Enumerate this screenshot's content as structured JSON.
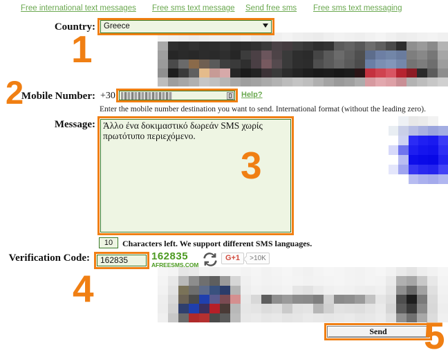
{
  "linkbar": {
    "links": [
      "Free international text messages",
      "Free sms text message",
      "Send free sms",
      "Free sms text messaging"
    ]
  },
  "form": {
    "country_label": "Country:",
    "country_value": "Greece",
    "mobile_label": "Mobile Number:",
    "mobile_prefix": "+30",
    "mobile_value": "",
    "help_link": "Help?",
    "mobile_hint": "Enter the mobile number destination you want to send. International format (without the leading zero).",
    "message_label": "Message:",
    "message_value": "Άλλο ένα δοκιμαστικό δωρεάν SMS χωρίς πρωτότυπο περιεχόμενο.",
    "chars_left_value": "10",
    "chars_left_text": "Characters left. We support different SMS languages.",
    "verify_label": "Verification Code:",
    "verify_value": "162835",
    "send_label": "Send"
  },
  "captcha": {
    "code": "162835",
    "brand": "AFREESMS.COM",
    "refresh_icon": "refresh-icon"
  },
  "social": {
    "gplus_label": "G+1",
    "gplus_count": ">10K"
  },
  "steps": {
    "one": "1",
    "two": "2",
    "three": "3",
    "four": "4",
    "five": "5"
  },
  "colors": {
    "highlight": "#f07f13",
    "link_green": "#6aa84f",
    "field_bg": "#eef5e3",
    "field_border": "#3a7a28",
    "captcha_green": "#4c9a21",
    "gplus_red": "#d24b3e"
  },
  "ads": {
    "top": {
      "cols": 28,
      "rows": 6,
      "cells": [
        "#f4f4f4",
        "#f2f2f2",
        "#f0f0f0",
        "#ededed",
        "#efefef",
        "#f1f1f1",
        "#eeeeee",
        "#ececec",
        "#f0f0f0",
        "#eaeaea",
        "#e8e8e8",
        "#f0f0f0",
        "#f3f3f3",
        "#efefef",
        "#ededed",
        "#ebebeb",
        "#efefef",
        "#f2f2f2",
        "#f0f0f0",
        "#eeeeee",
        "#f1f1f1",
        "#f4f4f4",
        "#f0f0f0",
        "#ececec",
        "#eeeeee",
        "#f1f1f1",
        "#f3f3f3",
        "#f0f0f0",
        "#a9a9a9",
        "#2f2f2f",
        "#2b2b2b",
        "#303030",
        "#2c2c2c",
        "#2e2e2e",
        "#333333",
        "#2a2a2a",
        "#2d2d2d",
        "#313131",
        "#3a3a3a",
        "#4a4246",
        "#453c40",
        "#3d3d3d",
        "#363636",
        "#2e2e2e",
        "#333333",
        "#5b5b5b",
        "#636363",
        "#585858",
        "#6d6d6d",
        "#5f5f5f",
        "#4a4a4a",
        "#2d2d2d",
        "#8f8f8f",
        "#9a9a9a",
        "#8a8a8a",
        "#b4b4b4",
        "#9f9f9f",
        "#262626",
        "#2a2a2a",
        "#282828",
        "#2c2c2c",
        "#2a2a2a",
        "#2e2e2e",
        "#262626",
        "#3c3c3c",
        "#4b4045",
        "#6b555c",
        "#4d4347",
        "#3a3a3a",
        "#2e2e2e",
        "#2b2b2b",
        "#454545",
        "#5a5a5a",
        "#6b6b6b",
        "#5e5e5e",
        "#4f4f4f",
        "#5d6d8c",
        "#6d7fa4",
        "#7286a8",
        "#6a7c9e",
        "#7e7e7e",
        "#888888",
        "#777777",
        "#a6a6a6",
        "#9a9a9a",
        "#4a4a4a",
        "#6a6a6a",
        "#8a6a4a",
        "#6f5f52",
        "#5a5a5a",
        "#3e3e3e",
        "#3a3a3a",
        "#2f2f2f",
        "#4a3f44",
        "#77595f",
        "#554a4e",
        "#3a3a3a",
        "#2e2e2e",
        "#2c2c2c",
        "#4e4e4e",
        "#5a5a5a",
        "#666666",
        "#5a5a5a",
        "#4c4c4c",
        "#6a7fa6",
        "#7b8fb3",
        "#8296ba",
        "#7487ab",
        "#747474",
        "#7d7d7d",
        "#6e6e6e",
        "#9d9d9d",
        "#8f8f8f",
        "#1d1d1d",
        "#3a3a3a",
        "#5f5f5f",
        "#e4bb8b",
        "#c79b96",
        "#d6a9a9",
        "#262626",
        "#1b1b1b",
        "#222222",
        "#3c3236",
        "#3a3a3a",
        "#2c2c2c",
        "#242424",
        "#1e1e1e",
        "#1a1a1a",
        "#1c1c1c",
        "#181818",
        "#1b1b1b",
        "#2a1416",
        "#c4313f",
        "#cf4350",
        "#d85563",
        "#b62330",
        "#8c1b24",
        "#2a2a2a",
        "#5c5c5c",
        "#8e8e8e",
        "#bdbdbd",
        "#9d9d9d",
        "#a6a6a6",
        "#b0b0b0",
        "#c6c6c6",
        "#c0c0c0",
        "#b6b6b6",
        "#a8a8a8",
        "#9e9e9e",
        "#a2a2a2",
        "#aaaaaa",
        "#b2b2b2",
        "#bcbcbc",
        "#c4c4c4",
        "#bebebe",
        "#b0b0b0",
        "#a4a4a4",
        "#9a9a9a",
        "#a0a0a0",
        "#acacac",
        "#d79aa0",
        "#e2a8ae",
        "#dda0a6",
        "#c98f95",
        "#b3b3b3",
        "#bdbdbd",
        "#c7c7c7",
        "#d0d0d0"
      ]
    },
    "right": {
      "cols": 6,
      "rows": 7,
      "cells": [
        "#ffffff",
        "#eef1f5",
        "#e8e8e8",
        "#ebebeb",
        "#f2f2f2",
        "#ffffff",
        "#e9eef3",
        "#c9cfe8",
        "#b6bde4",
        "#a8b0e0",
        "#9aa4dd",
        "#a3ade2",
        "#ffffff",
        "#cdd2f2",
        "#2b2bf5",
        "#1f1ff2",
        "#1a1af0",
        "#3a3af6",
        "#d7d9fa",
        "#6f74ee",
        "#1e1ef0",
        "#1515ee",
        "#1212ec",
        "#2e2ef4",
        "#ffffff",
        "#b8bcf2",
        "#0e0eea",
        "#0a0ae8",
        "#0808e6",
        "#2222f0",
        "#e4e6fb",
        "#9fa4ef",
        "#3636f2",
        "#2929f0",
        "#2424ee",
        "#4242f6",
        "#ffffff",
        "#ffffff",
        "#b7bcf1",
        "#aab0ee",
        "#a4aaec",
        "#b0b6f0"
      ]
    },
    "bottom": {
      "cols": 28,
      "rows": 6,
      "cells": [
        "#f6f6f6",
        "#f4f4f4",
        "#e6e6e6",
        "#e9e9e9",
        "#f2f2f2",
        "#f0f0f0",
        "#f4f4f4",
        "#f6f6f6",
        "#f3f3f3",
        "#f5f5f5",
        "#f2f2f2",
        "#f4f4f4",
        "#f6f6f6",
        "#f3f3f3",
        "#f1f1f1",
        "#f4f4f4",
        "#f6f6f6",
        "#f5f5f5",
        "#f3f3f3",
        "#f2f2f2",
        "#f4f4f4",
        "#f6f6f6",
        "#f2f2f2",
        "#eaeaea",
        "#e4e4e4",
        "#eeeeee",
        "#f2f2f2",
        "#f6f6f6",
        "#f4f4f4",
        "#e8e8e8",
        "#b9b9b9",
        "#8d8d8d",
        "#6f6f6f",
        "#5e5e5e",
        "#9a9a9a",
        "#d6d6d6",
        "#f0f0f0",
        "#f4f4f4",
        "#f2f2f2",
        "#f3f3f3",
        "#f5f5f5",
        "#f4f4f4",
        "#f2f2f2",
        "#f3f3f3",
        "#f4f4f4",
        "#f5f5f5",
        "#f3f3f3",
        "#f2f2f2",
        "#f4f4f4",
        "#f3f3f3",
        "#eaeaea",
        "#b0b0b0",
        "#a6a6a6",
        "#c8c8c8",
        "#e8e8e8",
        "#f4f4f4",
        "#f2f2f2",
        "#e2e2e2",
        "#7a7258",
        "#6e6e6e",
        "#5d6b8a",
        "#39517e",
        "#2a3c6a",
        "#b4b4b4",
        "#eeeeee",
        "#f2f2f2",
        "#f0f0f0",
        "#f1f1f1",
        "#f3f3f3",
        "#e6e6e6",
        "#e2e2e2",
        "#eaeaea",
        "#f0f0f0",
        "#f2f2f2",
        "#f1f1f1",
        "#eeeeee",
        "#ededed",
        "#f0f0f0",
        "#e4e4e4",
        "#8f8f8f",
        "#6a6a6a",
        "#a2a2a2",
        "#e0e0e0",
        "#f2f2f2",
        "#eeeeee",
        "#d9d9d9",
        "#6b6254",
        "#4a4a4a",
        "#1f3fae",
        "#5a5a8e",
        "#7a4a52",
        "#d58f8f",
        "#e8e8e8",
        "#d8d8d8",
        "#5e5e5e",
        "#8e8e8e",
        "#9a9a9a",
        "#8c8c8c",
        "#8a8a8a",
        "#7e7e7e",
        "#d4d4d4",
        "#8a8a8a",
        "#8e8e8e",
        "#9a9a9a",
        "#c2c2c2",
        "#e6e6e6",
        "#dcdcdc",
        "#4e4e4e",
        "#1e1e1e",
        "#7a7a7a",
        "#dadada",
        "#f0f0f0",
        "#ededed",
        "#d2d2d2",
        "#2f3f6e",
        "#1f3fae",
        "#3a2f5e",
        "#b61f28",
        "#4a3a36",
        "#b8b8b8",
        "#e6e6e6",
        "#e4e4e4",
        "#dcdcdc",
        "#e0e0e0",
        "#cacaca",
        "#e2e2e2",
        "#e4e4e4",
        "#b6b6b6",
        "#d0d0d0",
        "#e2e2e2",
        "#e0e0e0",
        "#dedede",
        "#e4e4e4",
        "#eaeaea",
        "#d6d6d6",
        "#5c5c5c",
        "#3a3a3a",
        "#8a8a8a",
        "#d8d8d8",
        "#eeeeee",
        "#f0f0f0",
        "#c8c8c8",
        "#6a6a6a",
        "#b02a2a",
        "#b43030",
        "#4a4a4a",
        "#5a5a5a",
        "#bdbdbd",
        "#e8e8e8",
        "#eaeaea",
        "#e6e6e6",
        "#e8e8e8",
        "#e4e4e4",
        "#e6e6e6",
        "#eaeaea",
        "#e8e8e8",
        "#e6e6e6",
        "#e8e8e8",
        "#eaeaea",
        "#e6e6e6",
        "#e8e8e8",
        "#ececec",
        "#e0e0e0",
        "#909090",
        "#707070",
        "#a8a8a8",
        "#dcdcdc",
        "#f0f0f0"
      ]
    }
  }
}
